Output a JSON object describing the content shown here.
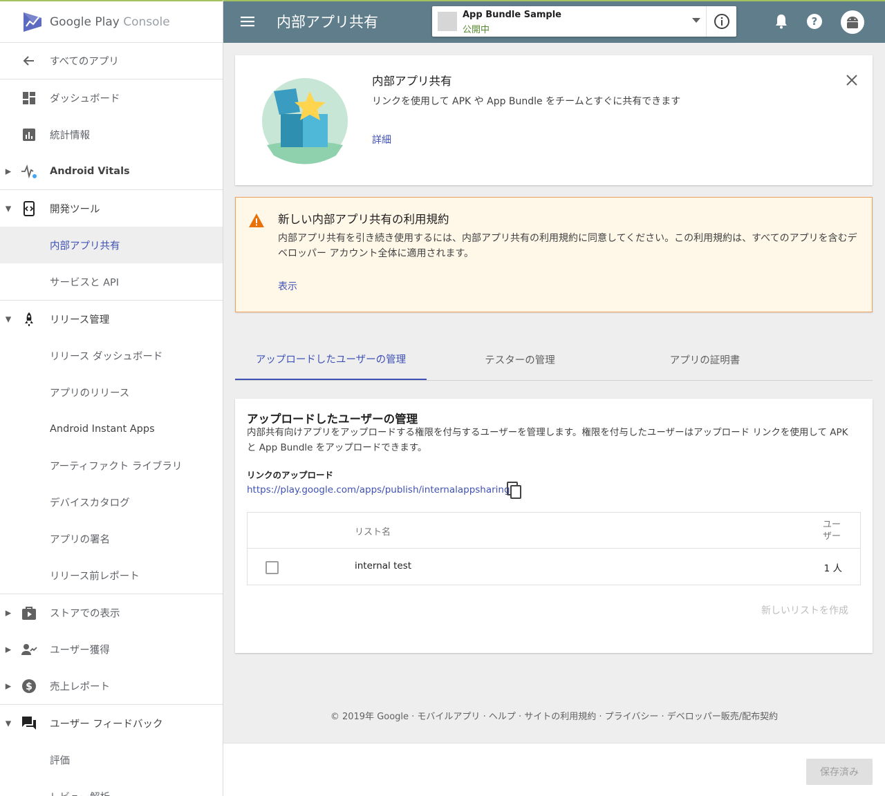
{
  "brand": {
    "name_main": "Google Play",
    "name_sub": "Console"
  },
  "sidebar": {
    "back": {
      "label": "すべてのアプリ",
      "icon": "arrow-back-icon"
    },
    "items": [
      {
        "label": "ダッシュボード",
        "icon": "dashboard-icon"
      },
      {
        "label": "統計情報",
        "icon": "stats-icon"
      },
      {
        "label": "Android Vitals",
        "icon": "vitals-icon"
      },
      {
        "label": "開発ツール",
        "icon": "dev-tools-icon"
      },
      {
        "label": "内部アプリ共有"
      },
      {
        "label": "サービスと API"
      },
      {
        "label": "リリース管理",
        "icon": "rocket-icon"
      },
      {
        "label": "リリース ダッシュボード"
      },
      {
        "label": "アプリのリリース"
      },
      {
        "label": "Android Instant Apps"
      },
      {
        "label": "アーティファクト ライブラリ"
      },
      {
        "label": "デバイスカタログ"
      },
      {
        "label": "アプリの署名"
      },
      {
        "label": "リリース前レポート"
      },
      {
        "label": "ストアでの表示",
        "icon": "store-icon"
      },
      {
        "label": "ユーザー獲得",
        "icon": "acquisition-icon"
      },
      {
        "label": "売上レポート",
        "icon": "dollar-icon"
      },
      {
        "label": "ユーザー フィードバック",
        "icon": "feedback-icon"
      },
      {
        "label": "評価"
      },
      {
        "label": "レビュー解析"
      }
    ]
  },
  "topbar": {
    "title": "内部アプリ共有",
    "app": {
      "name": "App Bundle Sample",
      "status": "公開中"
    }
  },
  "intro": {
    "title": "内部アプリ共有",
    "description": "リンクを使用して APK や App Bundle をチームとすぐに共有できます",
    "link": "詳細"
  },
  "warning": {
    "title": "新しい内部アプリ共有の利用規約",
    "body": "内部アプリ共有を引き続き使用するには、内部アプリ共有の利用規約に同意してください。この利用規約は、すべてのアプリを含むデベロッパー アカウント全体に適用されます。",
    "link": "表示"
  },
  "tabs": [
    {
      "label": "アップロードしたユーザーの管理",
      "active": true
    },
    {
      "label": "テスターの管理",
      "active": false
    },
    {
      "label": "アプリの証明書",
      "active": false
    }
  ],
  "uploaders": {
    "title": "アップロードしたユーザーの管理",
    "description": "内部共有向けアプリをアップロードする権限を付与するユーザーを管理します。権限を付与したユーザーはアップロード リンクを使用して APK と App Bundle をアップロードできます。",
    "link_label": "リンクのアップロード",
    "link_url": "https://play.google.com/apps/publish/internalappsharing",
    "table": {
      "columns": [
        "リスト名",
        "ユーザー"
      ],
      "rows": [
        {
          "name": "internal test",
          "users": "1 人",
          "checked": false
        }
      ]
    },
    "new_list": "新しいリストを作成"
  },
  "footer": "© 2019年 Google · モバイルアプリ · ヘルプ · サイトの利用規約 · プライバシー · デベロッパー販売/配布契約",
  "save_button": "保存済み",
  "colors": {
    "topbar": "#607d8b",
    "accent": "#3f51b5",
    "warning_bg": "#fff8e9",
    "warning_border": "#f0a05a",
    "status_green": "#558b2f"
  }
}
